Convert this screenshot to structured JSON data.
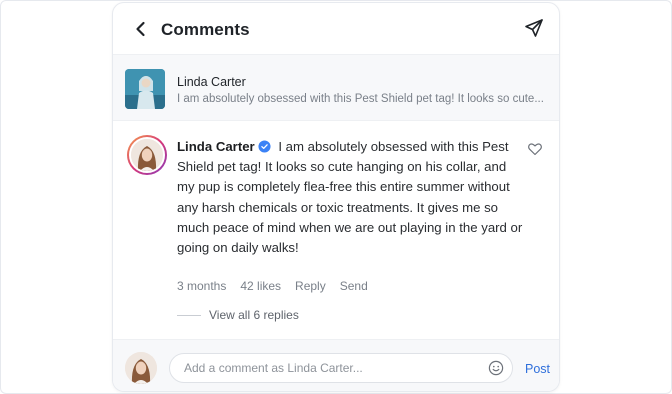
{
  "header": {
    "title": "Comments",
    "back_icon": "chevron-left-icon",
    "send_icon": "paper-plane-icon"
  },
  "post": {
    "author": "Linda Carter",
    "snippet": "I am absolutely obsessed with this Pest Shield pet tag! It looks so cute..."
  },
  "comment": {
    "author": "Linda Carter",
    "verified": true,
    "verified_color": "#3b82f6",
    "text": "I am absolutely obsessed with this Pest Shield pet tag! It looks so cute hanging on his collar, and my pup is completely flea-free this entire summer without any harsh chemicals or toxic treatments. It gives me so much peace of mind when we are out playing in the yard or going on daily walks!",
    "time": "3 months",
    "likes": "42 likes",
    "reply_label": "Reply",
    "send_label": "Send",
    "view_replies": "View all 6 replies"
  },
  "composer": {
    "placeholder": "Add a comment as Linda Carter...",
    "post_label": "Post",
    "accent": "#2f6fdb"
  }
}
